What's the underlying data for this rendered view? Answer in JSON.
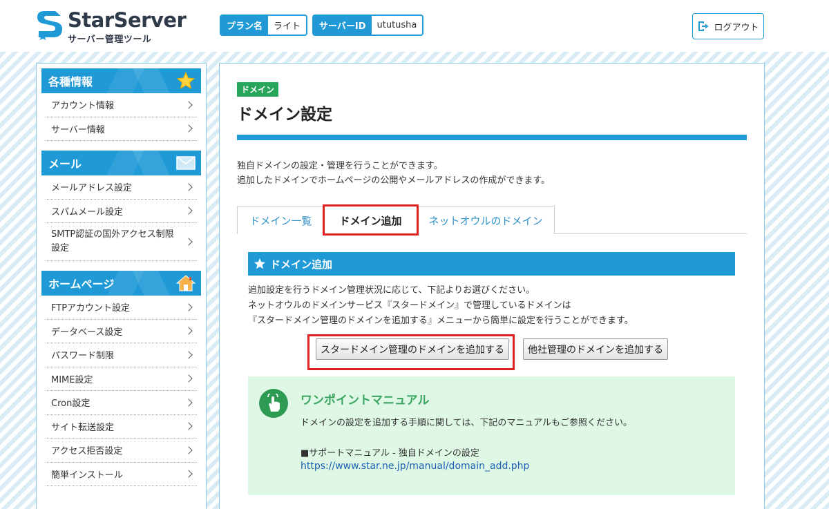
{
  "header": {
    "logo_title": "StarServer",
    "logo_sub": "サーバー管理ツール",
    "plan_label": "プラン名",
    "plan_value": "ライト",
    "server_label": "サーバーID",
    "server_value": "ututusha",
    "logout": "ログアウト"
  },
  "sidebar": {
    "sections": [
      {
        "title": "各種情報",
        "icon": "star-icon",
        "items": [
          "アカウント情報",
          "サーバー情報"
        ]
      },
      {
        "title": "メール",
        "icon": "mail-icon",
        "items": [
          "メールアドレス設定",
          "スパムメール設定",
          "SMTP認証の国外アクセス制限設定"
        ]
      },
      {
        "title": "ホームページ",
        "icon": "home-icon",
        "items": [
          "FTPアカウント設定",
          "データベース設定",
          "パスワード制限",
          "MIME設定",
          "Cron設定",
          "サイト転送設定",
          "アクセス拒否設定",
          "簡単インストール"
        ]
      }
    ]
  },
  "main": {
    "badge": "ドメイン",
    "title": "ドメイン設定",
    "intro_1": "独自ドメインの設定・管理を行うことができます。",
    "intro_2": "追加したドメインでホームページの公開やメールアドレスの作成ができます。",
    "tabs": [
      "ドメイン一覧",
      "ドメイン追加",
      "ネットオウルのドメイン"
    ],
    "panel_title": "ドメイン追加",
    "panel_text_1": "追加設定を行うドメイン管理状況に応じて、下記よりお選びください。",
    "panel_text_2": "ネットオウルのドメインサービス『スタードメイン』で管理しているドメインは",
    "panel_text_3": "『スタードメイン管理のドメインを追加する』メニューから簡単に設定を行うことができます。",
    "btn_star": "スタードメイン管理のドメインを追加する",
    "btn_other": "他社管理のドメインを追加する",
    "manual_title": "ワンポイントマニュアル",
    "manual_desc": "ドメインの設定を追加する手順に関しては、下記のマニュアルもご参照ください。",
    "manual_link_label": "■サポートマニュアル - 独自ドメインの設定",
    "manual_url": "https://www.star.ne.jp/manual/domain_add.php"
  },
  "colors": {
    "accent": "#1f9ad6",
    "badge": "#27a55a",
    "highlight": "#e02020",
    "manual_bg": "#dff8e6"
  }
}
